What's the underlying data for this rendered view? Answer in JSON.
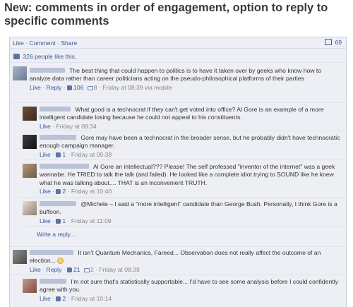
{
  "headline": "New: comments in order of engagement, option to reply to specific comments",
  "topbar": {
    "like": "Like",
    "comment": "Comment",
    "share": "Share",
    "dot": "·",
    "count": "69"
  },
  "likes": {
    "text": "326 people like this."
  },
  "comments": [
    {
      "text": "The best thing that could happen to politics is to have it taken over by geeks who know how to analyze data rather than career politicians acting on the pseudo-philosophical platforms of their parties",
      "like": "Like",
      "reply": "Reply",
      "likes": "106",
      "replies": "8",
      "time": "Friday at 08:39 via mobile"
    },
    {
      "text": "What good is a technocrat if they can't get voted into office? Al Gore is an example of a more intelligent candidate losing because he could not appeal to his constituents.",
      "like": "Like",
      "time": "Friday at 09:34"
    },
    {
      "text": "Gore may have been a technocrat in the broader sense, but he probably didn't have technocratic enough campaign manager.",
      "like": "Like",
      "likes": "1",
      "time": "Friday at 09:38"
    },
    {
      "text": "Al Gore an intellectual??? Please! The self professed \"inventor of the internet\" was a geek wannabe. He TRIED to talk the talk (and failed). He looked like a complete idiot trying to SOUND like he knew what he was talking about.... THAT is an inconvenient TRUTH.",
      "like": "Like",
      "likes": "2",
      "time": "Friday at 10:40"
    },
    {
      "text": "@Michele – I said a \"more intelligent\" candidate than George Bush. Personally, I think Gore is a buffoon.",
      "like": "Like",
      "likes": "1",
      "time": "Friday at 11:09"
    },
    {
      "text": "It isn't Quantum Mechanics, Fareed... Observation does not really affect the outcome of an election...",
      "like": "Like",
      "reply": "Reply",
      "likes": "21",
      "replies": "2",
      "time": "Friday at 08:39"
    },
    {
      "text": "I'm not sure that's statistically supportable... I'd have to see some analysis before I could confidently agree with you.",
      "like": "Like",
      "likes": "2",
      "time": "Friday at 10:14"
    }
  ],
  "write_reply": "Write a reply...",
  "icons": {
    "like": "thumbs-up-icon",
    "comment": "speech-bubble-icon",
    "smiley": "smiley-icon",
    "count": "comment-count-icon"
  },
  "colors": {
    "link": "#3b5998",
    "panel": "#edeff4",
    "meta": "#888888"
  }
}
